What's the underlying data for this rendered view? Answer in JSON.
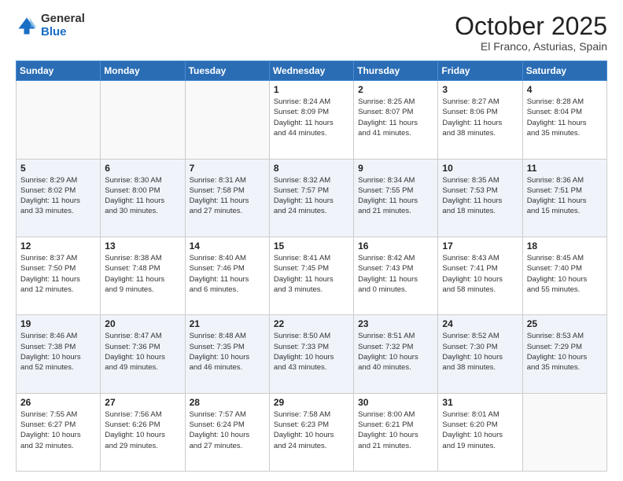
{
  "logo": {
    "general": "General",
    "blue": "Blue"
  },
  "header": {
    "month": "October 2025",
    "location": "El Franco, Asturias, Spain"
  },
  "weekdays": [
    "Sunday",
    "Monday",
    "Tuesday",
    "Wednesday",
    "Thursday",
    "Friday",
    "Saturday"
  ],
  "weeks": [
    [
      {
        "day": "",
        "info": ""
      },
      {
        "day": "",
        "info": ""
      },
      {
        "day": "",
        "info": ""
      },
      {
        "day": "1",
        "info": "Sunrise: 8:24 AM\nSunset: 8:09 PM\nDaylight: 11 hours\nand 44 minutes."
      },
      {
        "day": "2",
        "info": "Sunrise: 8:25 AM\nSunset: 8:07 PM\nDaylight: 11 hours\nand 41 minutes."
      },
      {
        "day": "3",
        "info": "Sunrise: 8:27 AM\nSunset: 8:06 PM\nDaylight: 11 hours\nand 38 minutes."
      },
      {
        "day": "4",
        "info": "Sunrise: 8:28 AM\nSunset: 8:04 PM\nDaylight: 11 hours\nand 35 minutes."
      }
    ],
    [
      {
        "day": "5",
        "info": "Sunrise: 8:29 AM\nSunset: 8:02 PM\nDaylight: 11 hours\nand 33 minutes."
      },
      {
        "day": "6",
        "info": "Sunrise: 8:30 AM\nSunset: 8:00 PM\nDaylight: 11 hours\nand 30 minutes."
      },
      {
        "day": "7",
        "info": "Sunrise: 8:31 AM\nSunset: 7:58 PM\nDaylight: 11 hours\nand 27 minutes."
      },
      {
        "day": "8",
        "info": "Sunrise: 8:32 AM\nSunset: 7:57 PM\nDaylight: 11 hours\nand 24 minutes."
      },
      {
        "day": "9",
        "info": "Sunrise: 8:34 AM\nSunset: 7:55 PM\nDaylight: 11 hours\nand 21 minutes."
      },
      {
        "day": "10",
        "info": "Sunrise: 8:35 AM\nSunset: 7:53 PM\nDaylight: 11 hours\nand 18 minutes."
      },
      {
        "day": "11",
        "info": "Sunrise: 8:36 AM\nSunset: 7:51 PM\nDaylight: 11 hours\nand 15 minutes."
      }
    ],
    [
      {
        "day": "12",
        "info": "Sunrise: 8:37 AM\nSunset: 7:50 PM\nDaylight: 11 hours\nand 12 minutes."
      },
      {
        "day": "13",
        "info": "Sunrise: 8:38 AM\nSunset: 7:48 PM\nDaylight: 11 hours\nand 9 minutes."
      },
      {
        "day": "14",
        "info": "Sunrise: 8:40 AM\nSunset: 7:46 PM\nDaylight: 11 hours\nand 6 minutes."
      },
      {
        "day": "15",
        "info": "Sunrise: 8:41 AM\nSunset: 7:45 PM\nDaylight: 11 hours\nand 3 minutes."
      },
      {
        "day": "16",
        "info": "Sunrise: 8:42 AM\nSunset: 7:43 PM\nDaylight: 11 hours\nand 0 minutes."
      },
      {
        "day": "17",
        "info": "Sunrise: 8:43 AM\nSunset: 7:41 PM\nDaylight: 10 hours\nand 58 minutes."
      },
      {
        "day": "18",
        "info": "Sunrise: 8:45 AM\nSunset: 7:40 PM\nDaylight: 10 hours\nand 55 minutes."
      }
    ],
    [
      {
        "day": "19",
        "info": "Sunrise: 8:46 AM\nSunset: 7:38 PM\nDaylight: 10 hours\nand 52 minutes."
      },
      {
        "day": "20",
        "info": "Sunrise: 8:47 AM\nSunset: 7:36 PM\nDaylight: 10 hours\nand 49 minutes."
      },
      {
        "day": "21",
        "info": "Sunrise: 8:48 AM\nSunset: 7:35 PM\nDaylight: 10 hours\nand 46 minutes."
      },
      {
        "day": "22",
        "info": "Sunrise: 8:50 AM\nSunset: 7:33 PM\nDaylight: 10 hours\nand 43 minutes."
      },
      {
        "day": "23",
        "info": "Sunrise: 8:51 AM\nSunset: 7:32 PM\nDaylight: 10 hours\nand 40 minutes."
      },
      {
        "day": "24",
        "info": "Sunrise: 8:52 AM\nSunset: 7:30 PM\nDaylight: 10 hours\nand 38 minutes."
      },
      {
        "day": "25",
        "info": "Sunrise: 8:53 AM\nSunset: 7:29 PM\nDaylight: 10 hours\nand 35 minutes."
      }
    ],
    [
      {
        "day": "26",
        "info": "Sunrise: 7:55 AM\nSunset: 6:27 PM\nDaylight: 10 hours\nand 32 minutes."
      },
      {
        "day": "27",
        "info": "Sunrise: 7:56 AM\nSunset: 6:26 PM\nDaylight: 10 hours\nand 29 minutes."
      },
      {
        "day": "28",
        "info": "Sunrise: 7:57 AM\nSunset: 6:24 PM\nDaylight: 10 hours\nand 27 minutes."
      },
      {
        "day": "29",
        "info": "Sunrise: 7:58 AM\nSunset: 6:23 PM\nDaylight: 10 hours\nand 24 minutes."
      },
      {
        "day": "30",
        "info": "Sunrise: 8:00 AM\nSunset: 6:21 PM\nDaylight: 10 hours\nand 21 minutes."
      },
      {
        "day": "31",
        "info": "Sunrise: 8:01 AM\nSunset: 6:20 PM\nDaylight: 10 hours\nand 19 minutes."
      },
      {
        "day": "",
        "info": ""
      }
    ]
  ]
}
